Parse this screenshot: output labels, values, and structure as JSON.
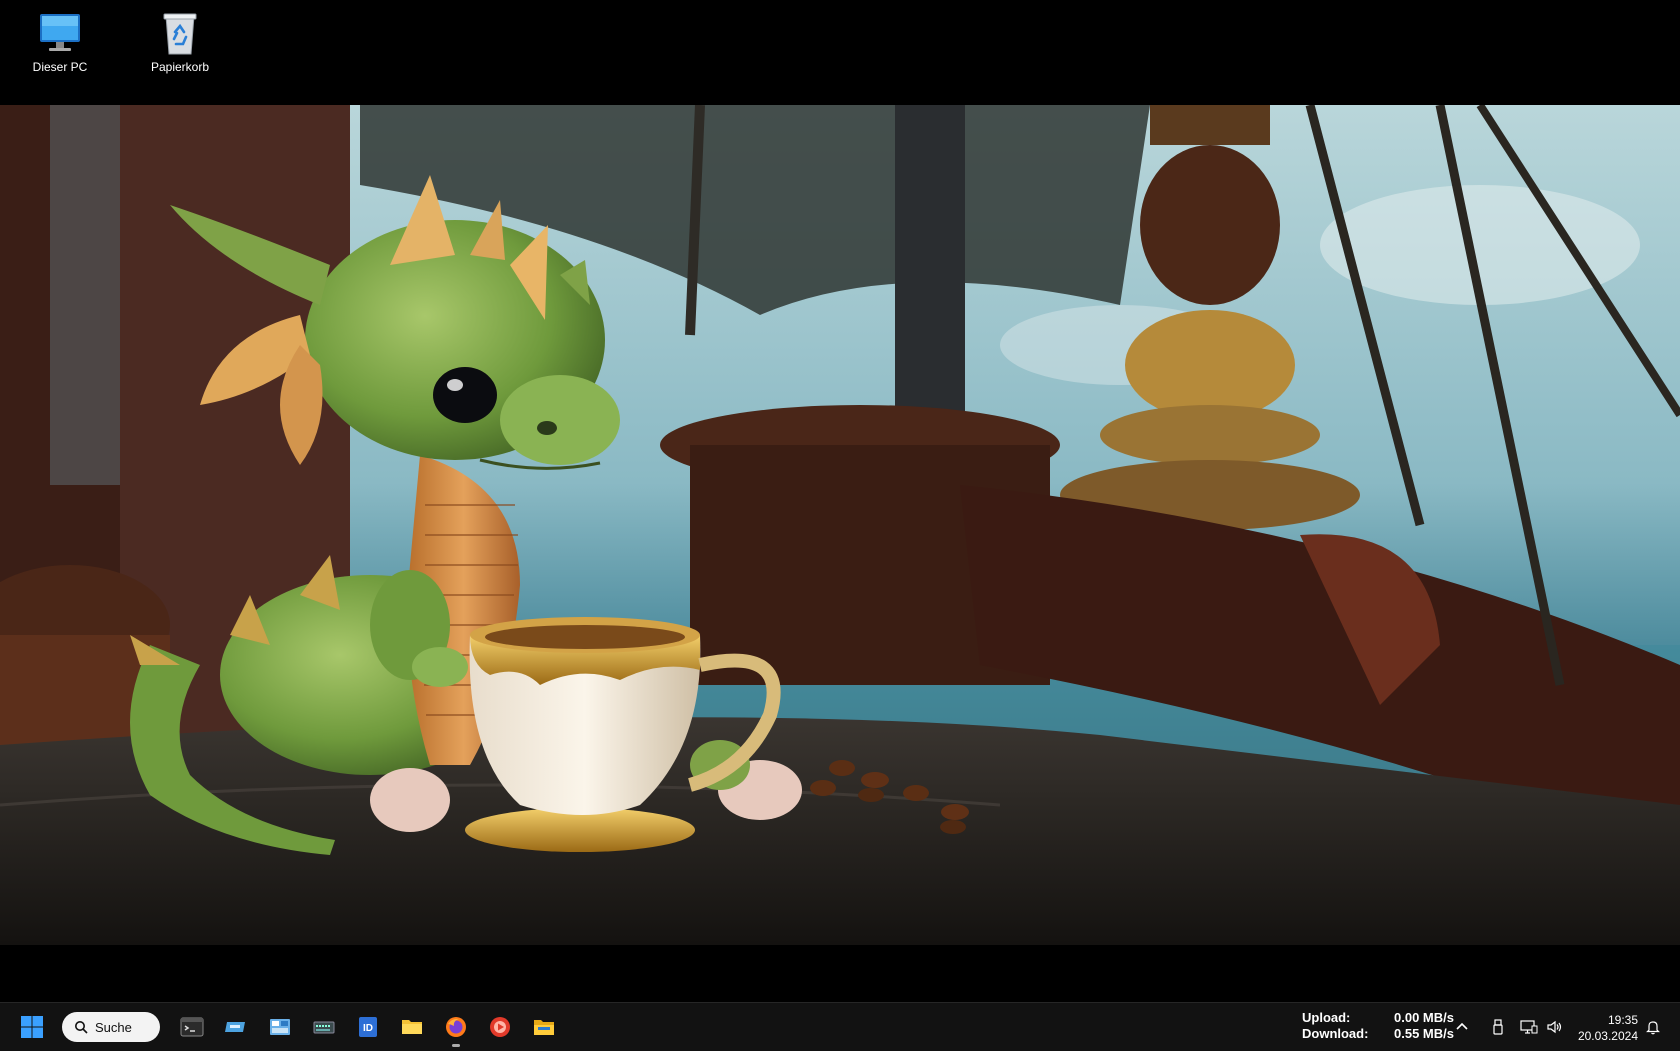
{
  "desktop": {
    "icons": [
      {
        "label": "Dieser PC",
        "icon": "monitor-icon"
      },
      {
        "label": "Papierkorb",
        "icon": "recycle-bin-icon"
      }
    ]
  },
  "taskbar": {
    "search_label": "Suche",
    "apps": [
      {
        "name": "terminal-icon"
      },
      {
        "name": "virtual-drive-icon"
      },
      {
        "name": "control-panel-icon"
      },
      {
        "name": "network-monitor-icon"
      },
      {
        "name": "id-app-icon"
      },
      {
        "name": "folder-icon"
      },
      {
        "name": "firefox-icon",
        "active": true
      },
      {
        "name": "media-player-icon"
      },
      {
        "name": "file-explorer-icon"
      }
    ],
    "network": {
      "upload_label": "Upload:",
      "upload_value": "0.00 MB/s",
      "download_label": "Download:",
      "download_value": "0.55 MB/s"
    },
    "tray_icons": [
      "chevron-up-icon",
      "usb-icon",
      "display-network-icon",
      "speaker-icon"
    ],
    "clock": {
      "time": "19:35",
      "date": "20.03.2024"
    },
    "notification_icon": "bell-icon"
  },
  "colors": {
    "taskbar_bg": "#121212",
    "accent_blue": "#3aa0ff"
  }
}
